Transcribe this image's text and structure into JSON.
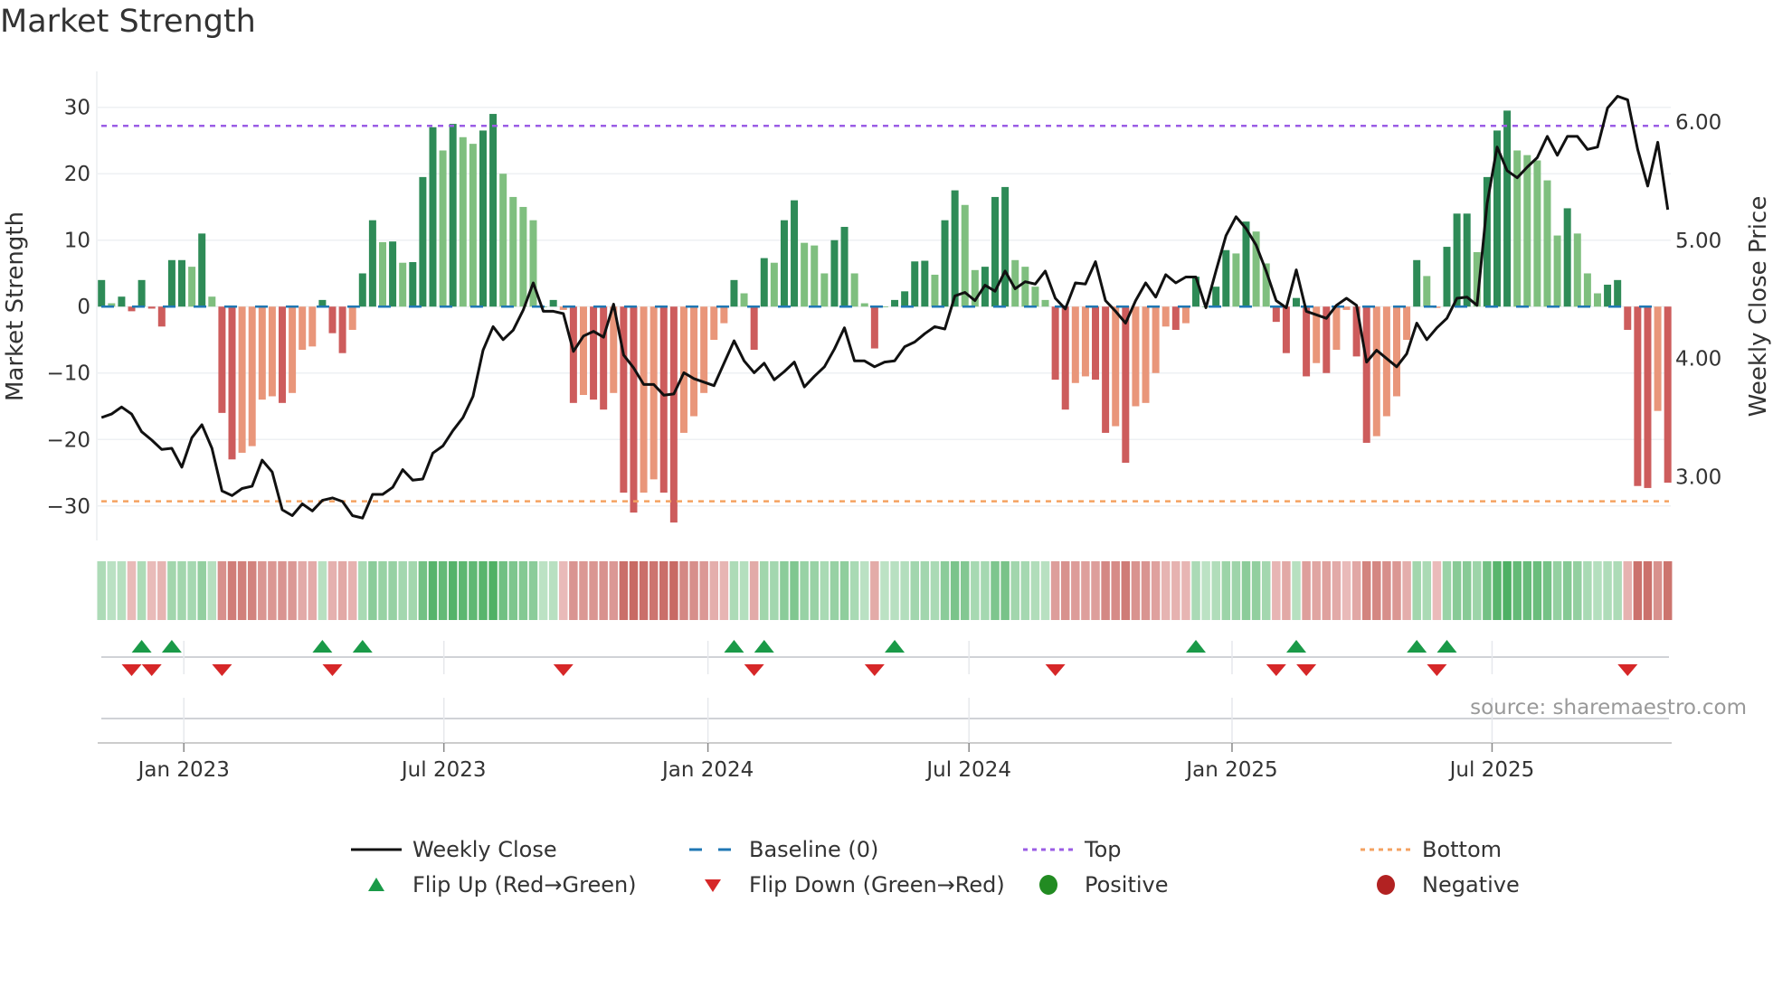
{
  "title": "Market Strength",
  "source": "source: sharemaestro.com",
  "colors": {
    "strong_green": "#2e8b57",
    "weak_green": "#7fbf7f",
    "strong_red": "#cd5c5c",
    "weak_red": "#e9967a",
    "price": "#111111",
    "baseline": "#1f77b4",
    "top": "#9b5de5",
    "bottom": "#f4a261",
    "flip_up": "#1a9a48",
    "flip_down": "#d62728",
    "positive": "#228b22",
    "negative": "#b22222"
  },
  "legend": [
    {
      "label": "Weekly Close",
      "marker": "solid-line",
      "color": "#111111"
    },
    {
      "label": "Baseline (0)",
      "marker": "dashed-line",
      "color": "#1f77b4"
    },
    {
      "label": "Top",
      "marker": "dotted-line",
      "color": "#9b5de5"
    },
    {
      "label": "Bottom",
      "marker": "dotted-line",
      "color": "#f4a261"
    },
    {
      "label": "Flip Up (Red→Green)",
      "marker": "triangle-up",
      "color": "#1a9a48"
    },
    {
      "label": "Flip Down (Green→Red)",
      "marker": "triangle-down",
      "color": "#d62728"
    },
    {
      "label": "Positive",
      "marker": "circle",
      "color": "#228b22"
    },
    {
      "label": "Negative",
      "marker": "circle",
      "color": "#b22222"
    }
  ],
  "chart_data": {
    "type": "bar",
    "title": "Market Strength",
    "ylabel": "Market Strength",
    "ylabel_right": "Weekly Close Price",
    "ylim": [
      -35.2,
      35.4
    ],
    "ylim_right": [
      2.46,
      6.43
    ],
    "yticks": [
      -30,
      -20,
      -10,
      0,
      10,
      20,
      30
    ],
    "ytick_labels": [
      "−30",
      "−20",
      "−10",
      "0",
      "10",
      "20",
      "30"
    ],
    "yticks_right": [
      3,
      4,
      5,
      6
    ],
    "ytick_labels_right": [
      "3.00",
      "4.00",
      "5.00",
      "6.00"
    ],
    "xlim_index": [
      -0.2,
      156.3
    ],
    "xticks": [
      {
        "label": "Jan 2023",
        "index": 8.2
      },
      {
        "label": "Jul 2023",
        "index": 34.1
      },
      {
        "label": "Jan 2024",
        "index": 60.4
      },
      {
        "label": "Jul 2024",
        "index": 86.4
      },
      {
        "label": "Jan 2025",
        "index": 112.6
      },
      {
        "label": "Jul 2025",
        "index": 138.5
      }
    ],
    "top_level": 27.2,
    "bottom_level": -29.3,
    "baseline": 0,
    "strength": [
      4,
      0.5,
      1.5,
      -0.7,
      4,
      -0.3,
      -3,
      7,
      7,
      6,
      11,
      1.5,
      -16,
      -23,
      -22,
      -21,
      -14,
      -13.5,
      -14.5,
      -13,
      -6.5,
      -6,
      1,
      -4,
      -7,
      -3.5,
      5,
      13,
      9.7,
      9.8,
      6.6,
      6.7,
      19.5,
      27,
      23.5,
      27.5,
      25.5,
      24.5,
      26.5,
      29,
      20,
      16.5,
      15,
      13,
      0,
      1,
      -0.5,
      -14.5,
      -13.3,
      -14,
      -15.5,
      -13,
      -28,
      -31,
      -28,
      -26,
      -28,
      -32.5,
      -19,
      -16.5,
      -13,
      -5,
      -2.5,
      4,
      2,
      -6.5,
      7.3,
      6.6,
      13,
      16,
      9.6,
      9.2,
      5,
      10,
      12,
      5,
      0.5,
      -6.3,
      0,
      1,
      2.3,
      6.8,
      6.9,
      4.8,
      13,
      17.5,
      15.3,
      5.5,
      6,
      16.5,
      18,
      7,
      6,
      3,
      1,
      -11,
      -15.5,
      -11.5,
      -10.5,
      -11,
      -19,
      -18,
      -23.5,
      -15,
      -14.5,
      -10,
      -3,
      -3.5,
      -2.5,
      4.5,
      0,
      3,
      8.5,
      8,
      12.8,
      11.3,
      6.5,
      -2.3,
      -7,
      1.3,
      -10.5,
      -8.5,
      -10,
      -6.5,
      -0.5,
      -7.5,
      -20.5,
      -19.5,
      -16.5,
      -13.5,
      -5,
      7,
      4.6,
      -0.2,
      9,
      14,
      14,
      8.2,
      19.5,
      26.5,
      29.5,
      23.5,
      22.8,
      22,
      19,
      10.7,
      14.8,
      11,
      5,
      2,
      3.3,
      4,
      -3.5,
      -27,
      -27.3,
      -15.7,
      -26.5
    ],
    "rising": [
      1,
      0,
      1,
      1,
      1,
      1,
      1,
      1,
      1,
      0,
      1,
      0,
      1,
      1,
      0,
      0,
      0,
      0,
      1,
      0,
      0,
      0,
      1,
      1,
      1,
      0,
      1,
      1,
      0,
      1,
      0,
      1,
      1,
      1,
      0,
      1,
      0,
      0,
      1,
      1,
      0,
      0,
      0,
      0,
      0,
      1,
      0,
      1,
      0,
      1,
      1,
      0,
      1,
      1,
      0,
      0,
      1,
      1,
      0,
      0,
      0,
      0,
      0,
      1,
      0,
      1,
      1,
      0,
      1,
      1,
      0,
      0,
      0,
      1,
      1,
      0,
      0,
      1,
      0,
      1,
      1,
      1,
      1,
      0,
      1,
      1,
      0,
      0,
      1,
      1,
      1,
      0,
      0,
      0,
      0,
      1,
      1,
      0,
      0,
      1,
      1,
      0,
      1,
      0,
      0,
      0,
      0,
      1,
      0,
      1,
      0,
      1,
      1,
      0,
      1,
      0,
      0,
      1,
      1,
      1,
      1,
      0,
      1,
      0,
      0,
      1,
      1,
      0,
      0,
      0,
      0,
      1,
      0,
      0,
      1,
      1,
      1,
      0,
      1,
      1,
      1,
      0,
      0,
      0,
      0,
      0,
      1,
      0,
      0,
      0,
      1,
      1,
      1,
      1,
      1,
      0,
      1
    ],
    "weekly_close": [
      3.5,
      3.53,
      3.59,
      3.53,
      3.38,
      3.31,
      3.23,
      3.24,
      3.08,
      3.33,
      3.44,
      3.24,
      2.88,
      2.84,
      2.9,
      2.92,
      3.14,
      3.04,
      2.72,
      2.67,
      2.77,
      2.71,
      2.8,
      2.82,
      2.79,
      2.67,
      2.65,
      2.85,
      2.85,
      2.91,
      3.06,
      2.97,
      2.98,
      3.2,
      3.26,
      3.39,
      3.5,
      3.68,
      4.07,
      4.27,
      4.16,
      4.24,
      4.41,
      4.64,
      4.4,
      4.4,
      4.38,
      4.06,
      4.19,
      4.23,
      4.18,
      4.46,
      4.03,
      3.92,
      3.78,
      3.78,
      3.69,
      3.7,
      3.88,
      3.83,
      3.8,
      3.77,
      3.96,
      4.15,
      3.98,
      3.88,
      3.96,
      3.82,
      3.89,
      3.97,
      3.76,
      3.85,
      3.93,
      4.08,
      4.26,
      3.98,
      3.98,
      3.93,
      3.97,
      3.98,
      4.1,
      4.14,
      4.21,
      4.27,
      4.25,
      4.53,
      4.56,
      4.49,
      4.62,
      4.57,
      4.74,
      4.59,
      4.65,
      4.63,
      4.74,
      4.51,
      4.42,
      4.64,
      4.63,
      4.82,
      4.49,
      4.4,
      4.3,
      4.49,
      4.64,
      4.52,
      4.71,
      4.64,
      4.69,
      4.69,
      4.43,
      4.74,
      5.04,
      5.2,
      5.1,
      4.96,
      4.74,
      4.49,
      4.43,
      4.75,
      4.4,
      4.37,
      4.34,
      4.45,
      4.51,
      4.45,
      3.97,
      4.07,
      4.0,
      3.93,
      4.04,
      4.3,
      4.16,
      4.26,
      4.34,
      4.51,
      4.52,
      4.45,
      5.31,
      5.79,
      5.59,
      5.53,
      5.62,
      5.7,
      5.88,
      5.72,
      5.88,
      5.88,
      5.77,
      5.79,
      6.12,
      6.22,
      6.19,
      5.77,
      5.46,
      5.83,
      5.26
    ],
    "flip_up_index": [
      4,
      7,
      22,
      26,
      63,
      66,
      79,
      109,
      119,
      131,
      134
    ],
    "flip_down_index": [
      3,
      5,
      12,
      23,
      46,
      65,
      77,
      95,
      117,
      120,
      133,
      152
    ]
  }
}
